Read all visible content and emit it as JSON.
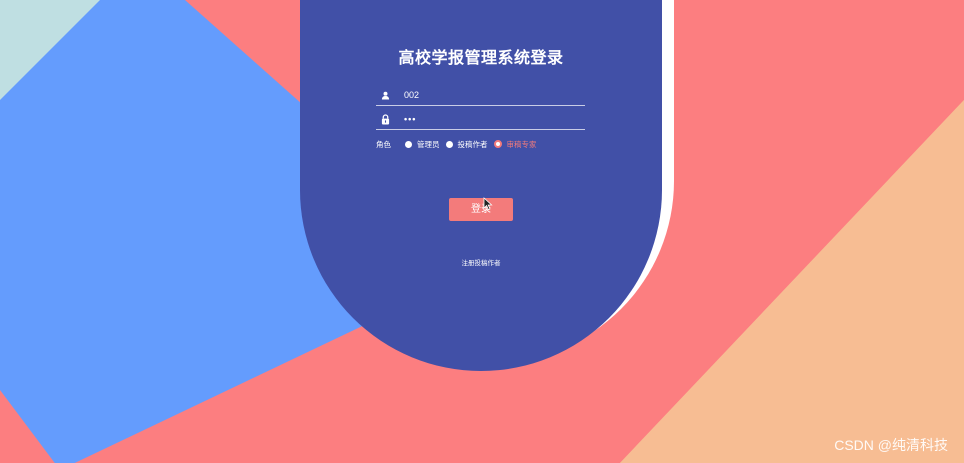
{
  "colors": {
    "card": "#4150a7",
    "accent": "#f37b7b",
    "blue": "#649cfd",
    "pink": "#fc7e80",
    "peach": "#f7bd93",
    "light": "#bfdfe2"
  },
  "login": {
    "title": "高校学报管理系统登录",
    "username": {
      "icon": "user-icon",
      "value": "002"
    },
    "password": {
      "icon": "lock-icon",
      "value": "•••"
    },
    "role": {
      "label": "角色",
      "options": [
        {
          "label": "管理员",
          "selected": false
        },
        {
          "label": "投稿作者",
          "selected": false
        },
        {
          "label": "审稿专家",
          "selected": true
        }
      ]
    },
    "submit_label": "登录",
    "register_label": "注册投稿作者"
  },
  "watermark": "CSDN @纯清科技"
}
